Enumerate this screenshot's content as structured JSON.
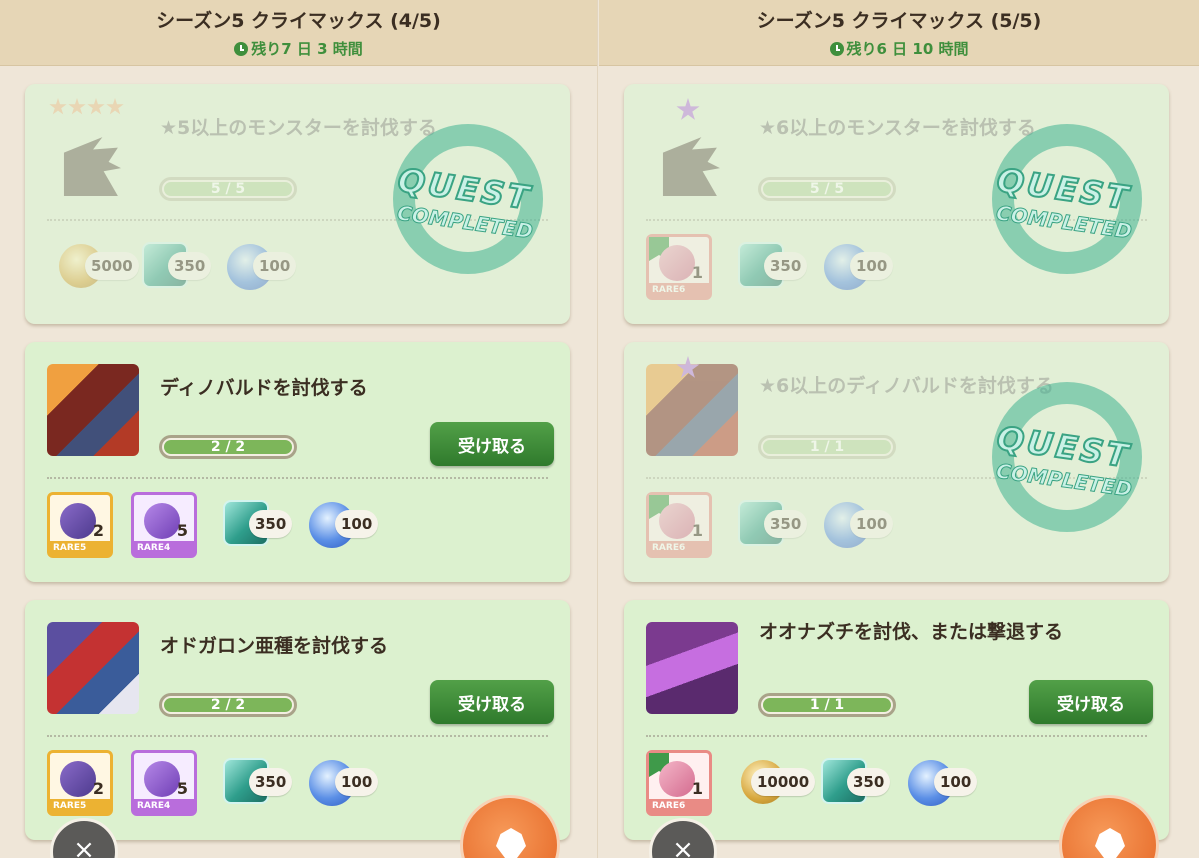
{
  "columns": [
    {
      "title": "シーズン5 クライマックス (4/5)",
      "timer": "残り7 日 3 時間",
      "quests": [
        {
          "title": "★5以上のモンスターを討伐する",
          "progress_text": "5 / 5",
          "progress": 1.0,
          "completed": true,
          "stars": 4,
          "rewards": [
            {
              "type": "coin",
              "count": "5000"
            },
            {
              "type": "gem",
              "count": "350"
            },
            {
              "type": "orb",
              "count": "100"
            }
          ]
        },
        {
          "title": "ディノバルドを討伐する",
          "progress_text": "2 / 2",
          "progress": 1.0,
          "completed": false,
          "claim_label": "受け取る",
          "rewards": [
            {
              "type": "item",
              "rarity": "RARE5",
              "count": "2"
            },
            {
              "type": "item",
              "rarity": "RARE4",
              "count": "5"
            },
            {
              "type": "gem",
              "count": "350"
            },
            {
              "type": "orb",
              "count": "100"
            }
          ]
        },
        {
          "title": "オドガロン亜種を討伐する",
          "progress_text": "2 / 2",
          "progress": 1.0,
          "completed": false,
          "claim_label": "受け取る",
          "rewards": [
            {
              "type": "item",
              "rarity": "RARE5",
              "count": "2"
            },
            {
              "type": "item",
              "rarity": "RARE4",
              "count": "5"
            },
            {
              "type": "gem",
              "count": "350"
            },
            {
              "type": "orb",
              "count": "100"
            }
          ]
        }
      ],
      "close_label": "×"
    },
    {
      "title": "シーズン5 クライマックス (5/5)",
      "timer": "残り6 日 10 時間",
      "quests": [
        {
          "title": "★6以上のモンスターを討伐する",
          "progress_text": "5 / 5",
          "progress": 1.0,
          "completed": true,
          "stars": 1,
          "rewards": [
            {
              "type": "item",
              "rarity": "RARE6",
              "count": "1"
            },
            {
              "type": "gem",
              "count": "350"
            },
            {
              "type": "orb",
              "count": "100"
            }
          ]
        },
        {
          "title": "★6以上のディノバルドを討伐する",
          "progress_text": "1 / 1",
          "progress": 1.0,
          "completed": true,
          "stars": 1,
          "rewards": [
            {
              "type": "item",
              "rarity": "RARE6",
              "count": "1"
            },
            {
              "type": "gem",
              "count": "350"
            },
            {
              "type": "orb",
              "count": "100"
            }
          ]
        },
        {
          "title": "オオナズチを討伐、または撃退する",
          "progress_text": "1 / 1",
          "progress": 1.0,
          "completed": false,
          "claim_label": "受け取る",
          "rewards": [
            {
              "type": "item",
              "rarity": "RARE6",
              "count": "1"
            },
            {
              "type": "coin",
              "count": "10000"
            },
            {
              "type": "gem",
              "count": "350"
            },
            {
              "type": "orb",
              "count": "100"
            }
          ]
        }
      ],
      "close_label": "×"
    }
  ],
  "stamp": {
    "line1": "QUEST",
    "line2": "COMPLETED"
  },
  "colors": {
    "accent_green": "#3f8f3c",
    "card_bg": "#dcf1cf",
    "header_bg": "#e6d6b6",
    "fab_orange": "#e46423"
  }
}
